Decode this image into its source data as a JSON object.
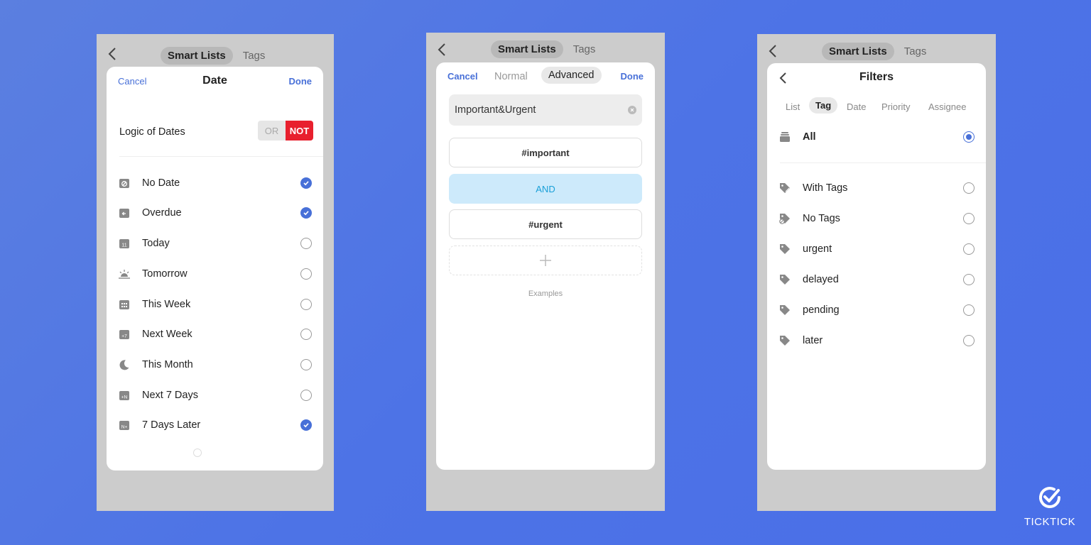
{
  "topnav": {
    "active": "Smart Lists",
    "inactive": "Tags"
  },
  "panel1": {
    "cancel": "Cancel",
    "title": "Date",
    "done": "Done",
    "logic_label": "Logic of Dates",
    "toggle_or": "OR",
    "toggle_not": "NOT",
    "items": [
      {
        "label": "No Date",
        "icon": "calendar-slash-icon",
        "checked": true
      },
      {
        "label": "Overdue",
        "icon": "calendar-arrow-icon",
        "checked": true
      },
      {
        "label": "Today",
        "icon": "calendar-11-icon",
        "checked": false
      },
      {
        "label": "Tomorrow",
        "icon": "sunrise-icon",
        "checked": false
      },
      {
        "label": "This Week",
        "icon": "calendar-grid-icon",
        "checked": false
      },
      {
        "label": "Next Week",
        "icon": "calendar-plus7-icon",
        "checked": false
      },
      {
        "label": "This Month",
        "icon": "moon-icon",
        "checked": false
      },
      {
        "label": "Next 7 Days",
        "icon": "calendar-plusN-icon",
        "checked": false
      },
      {
        "label": "7 Days Later",
        "icon": "calendar-Nplus-icon",
        "checked": true
      }
    ]
  },
  "panel2": {
    "cancel": "Cancel",
    "tab_normal": "Normal",
    "tab_advanced": "Advanced",
    "done": "Done",
    "name_value": "Important&Urgent",
    "cond1": "#important",
    "operator": "AND",
    "cond2": "#urgent",
    "examples": "Examples"
  },
  "panel3": {
    "title": "Filters",
    "tabs": [
      "List",
      "Tag",
      "Date",
      "Priority",
      "Assignee"
    ],
    "active_tab": "Tag",
    "all_label": "All",
    "items": [
      {
        "label": "With Tags",
        "icon": "tags-icon"
      },
      {
        "label": "No Tags",
        "icon": "no-tag-icon"
      },
      {
        "label": "urgent",
        "icon": "tag-icon"
      },
      {
        "label": "delayed",
        "icon": "tag-icon"
      },
      {
        "label": "pending",
        "icon": "tag-icon"
      },
      {
        "label": "later",
        "icon": "tag-icon"
      }
    ]
  },
  "brand": {
    "name": "TICKTICK"
  },
  "colors": {
    "accent": "#4870d8",
    "not_red": "#e8202e",
    "and_bg": "#cdeafb",
    "and_text": "#1aa0d8"
  }
}
